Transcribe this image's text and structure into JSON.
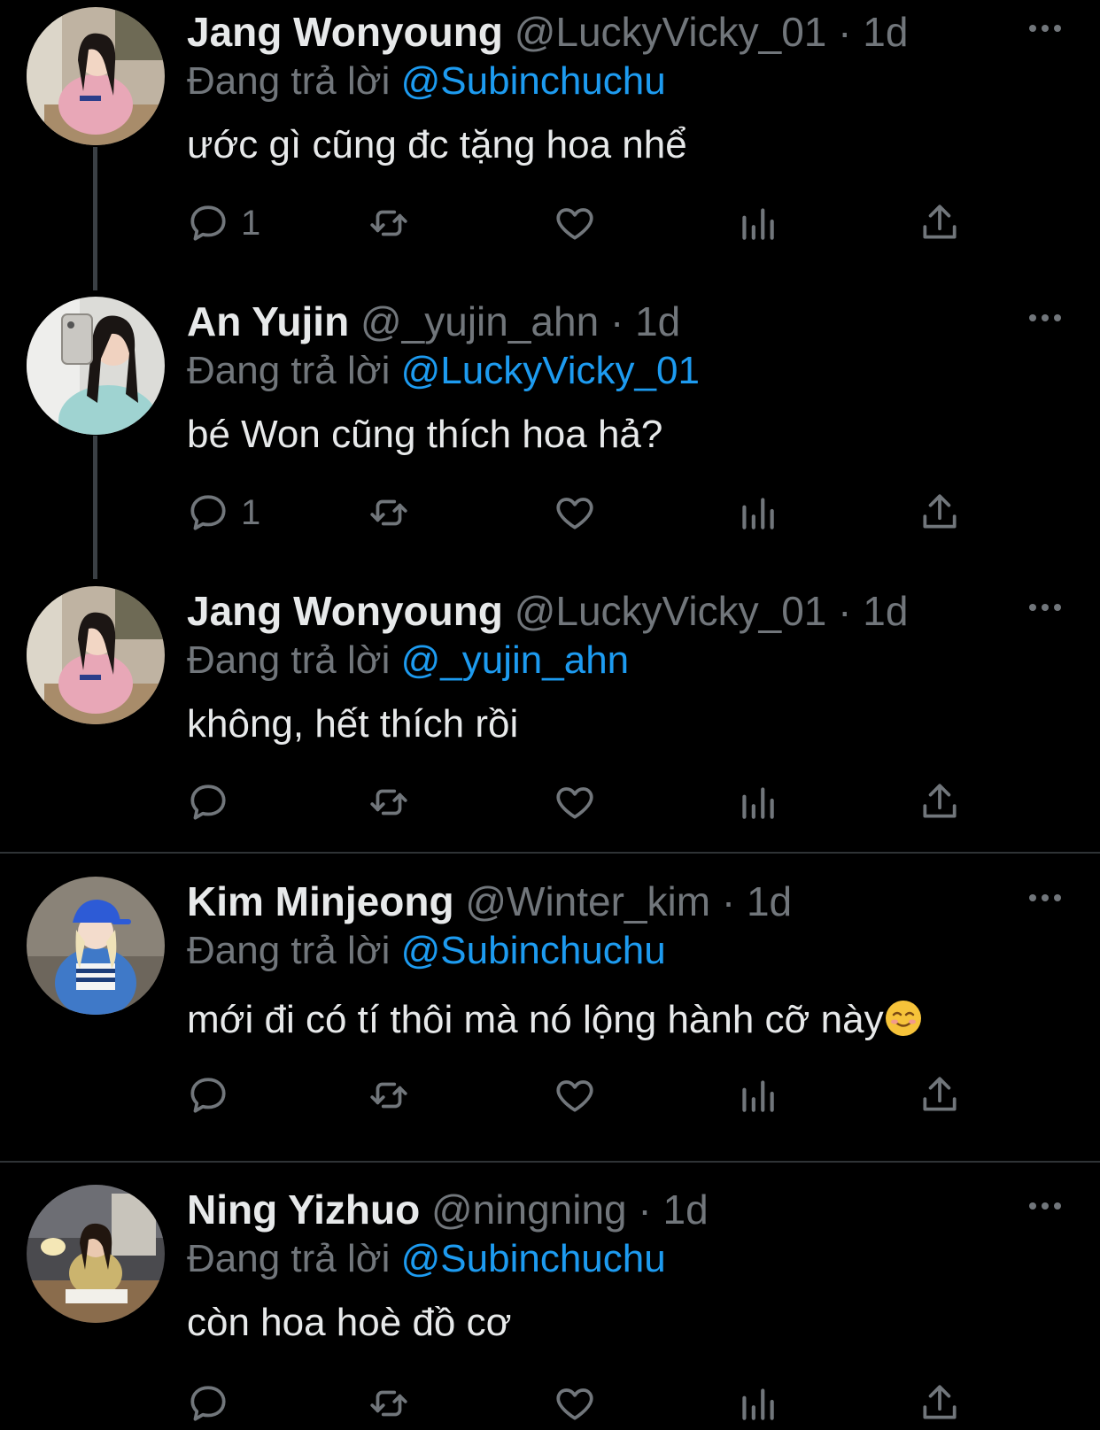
{
  "tweets": [
    {
      "name": "Jang Wonyoung",
      "handle": "@LuckyVicky_01",
      "dot": "·",
      "time": "1d",
      "reply_label": "Đang trả lời",
      "reply_to": "@Subinchuchu",
      "text": "ước gì cũng đc tặng hoa nhể",
      "reply_count": "1",
      "avatar": "avatar-photo-pink-sweater"
    },
    {
      "name": "An Yujin",
      "handle": "@_yujin_ahn",
      "dot": "·",
      "time": "1d",
      "reply_label": "Đang trả lời",
      "reply_to": "@LuckyVicky_01",
      "text": "bé Won cũng thích hoa hả?",
      "reply_count": "1",
      "avatar": "avatar-photo-mirror-selfie"
    },
    {
      "name": "Jang Wonyoung",
      "handle": "@LuckyVicky_01",
      "dot": "·",
      "time": "1d",
      "reply_label": "Đang trả lời",
      "reply_to": "@_yujin_ahn",
      "text": "không, hết thích rồi",
      "reply_count": "",
      "avatar": "avatar-photo-pink-sweater"
    },
    {
      "name": "Kim Minjeong",
      "handle": "@Winter_kim",
      "dot": "·",
      "time": "1d",
      "reply_label": "Đang trả lời",
      "reply_to": "@Subinchuchu",
      "text": "mới đi có tí thôi mà nó lộng hành cỡ này",
      "reply_count": "",
      "avatar": "avatar-photo-blue-cap"
    },
    {
      "name": "Ning Yizhuo",
      "handle": "@ningning",
      "dot": "·",
      "time": "1d",
      "reply_label": "Đang trả lời",
      "reply_to": "@Subinchuchu",
      "text": "còn hoa hoè đồ cơ",
      "reply_count": "",
      "avatar": "avatar-photo-reading"
    }
  ],
  "icons": {
    "reply": "reply-icon",
    "retweet": "retweet-icon",
    "like": "heart-icon",
    "views": "analytics-icon",
    "share": "share-icon",
    "more": "more-icon",
    "emoji": "smiling-face-emoji"
  },
  "colors": {
    "background": "#000000",
    "text": "#e7e9ea",
    "muted": "#71767b",
    "mention": "#1d9bf0"
  }
}
